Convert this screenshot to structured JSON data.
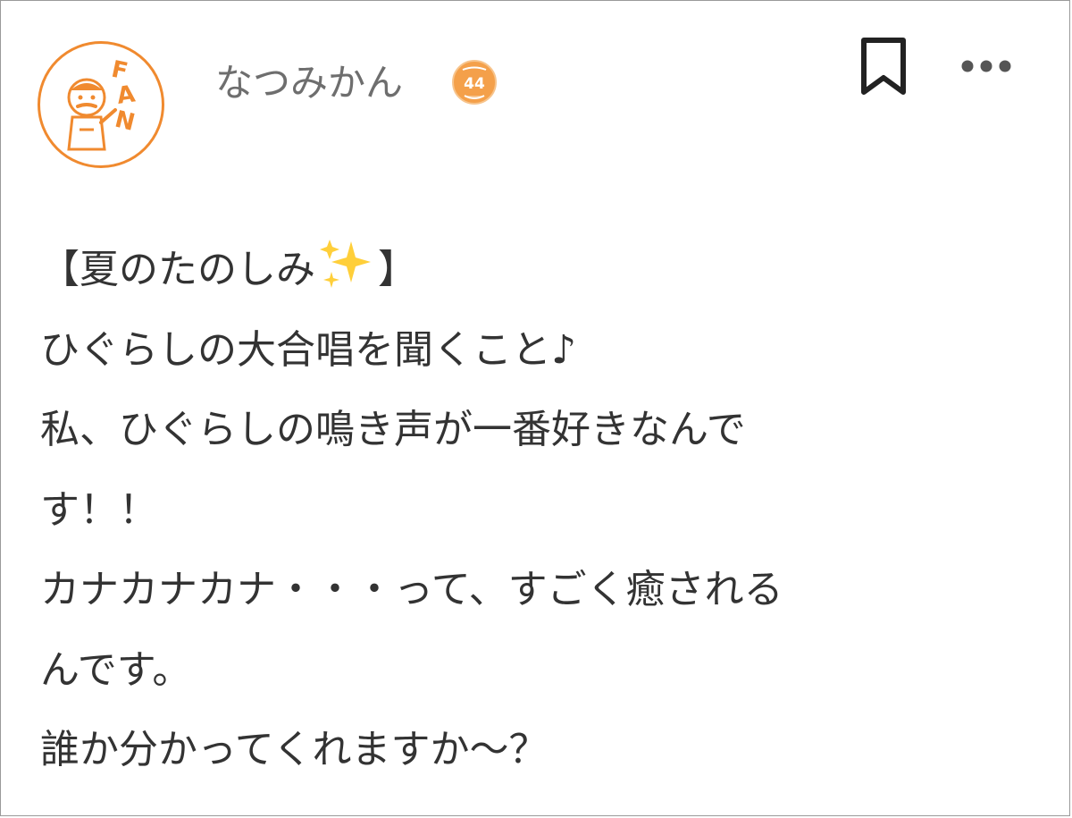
{
  "post": {
    "username": "なつみかん",
    "badge": {
      "top_text": "あなたのノート",
      "number": "44"
    },
    "avatar": {
      "logo_letters": "FAN"
    },
    "lines": {
      "l0_a": "【夏のたのしみ",
      "l0_b": "】",
      "l1": "ひぐらしの大合唱を聞くこと♪",
      "l2": "私、ひぐらしの鳴き声が一番好きなんで",
      "l3": "す！！",
      "l4": "カナカナカナ・・・って、すごく癒される",
      "l5": "んです。",
      "l6": "誰か分かってくれますか～？"
    }
  },
  "icons": {
    "bookmark": "bookmark-icon",
    "more": "more-options-icon",
    "sparkles": "sparkles-emoji"
  },
  "colors": {
    "brand_orange": "#f08a2f",
    "username_gray": "#6e6e6e",
    "body_text": "#333333",
    "icon_dark": "#222222"
  }
}
